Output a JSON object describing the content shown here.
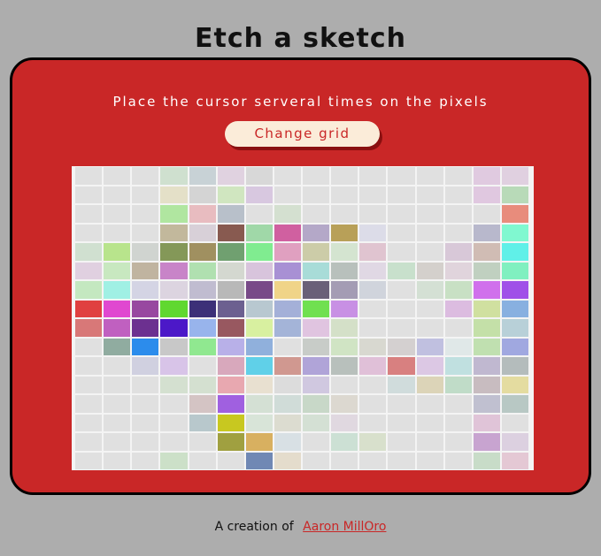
{
  "title": "Etch a sketch",
  "instruction": "Place the cursor serveral times on the pixels",
  "change_grid_label": "Change grid",
  "footer": {
    "prefix": "A creation of",
    "author": "Aaron MillOro"
  },
  "colors": {
    "background": "#adadad",
    "panel": "#c92727",
    "button_bg": "#fbecd9",
    "button_text": "#c92727",
    "empty_pixel": "#e0e0e0"
  },
  "grid": {
    "rows": 16,
    "cols": 16,
    "cells": [
      [
        "#e0e0e0",
        "#e0e0e0",
        "#e0e0e0",
        "#cfe0cf",
        "#c8d2d6",
        "#e0d2e0",
        "#d8d8d8",
        "#e0e0e0",
        "#e0e0e0",
        "#e0e0e0",
        "#e0e0e0",
        "#e0e0e0",
        "#e0e0e0",
        "#e0e0e0",
        "#e0cae0",
        "#e0d0e0"
      ],
      [
        "#e0e0e0",
        "#e0e0e0",
        "#e0e0e0",
        "#e4e0c8",
        "#d4d4d4",
        "#d0e6c0",
        "#d8c8e0",
        "#e0e0e0",
        "#e0e0e0",
        "#e0e0e0",
        "#e0e0e0",
        "#e0e0e0",
        "#e0e0e0",
        "#e0e0e0",
        "#e0c8e0",
        "#b8dab8"
      ],
      [
        "#e0e0e0",
        "#e0e0e0",
        "#e0e0e0",
        "#b0e6a0",
        "#e8bcc0",
        "#b8c0ca",
        "#e0e0e0",
        "#d4e0d0",
        "#e0e0e0",
        "#e0e0e0",
        "#e0e0e0",
        "#e0e0e0",
        "#e0e0e0",
        "#e0e0e0",
        "#e0e0e0",
        "#e88c7c"
      ],
      [
        "#e0e0e0",
        "#e0e0e0",
        "#e0e0e0",
        "#c2b89c",
        "#d8d0d8",
        "#885a50",
        "#a0d8a8",
        "#d060a0",
        "#b4a8c8",
        "#b8a058",
        "#dcdce8",
        "#e0e0e0",
        "#e0e0e0",
        "#e0e0e0",
        "#b8b8cc",
        "#80f8d0"
      ],
      [
        "#d0e0d0",
        "#b8e48c",
        "#d0d4d0",
        "#849858",
        "#a09060",
        "#70a070",
        "#80ec90",
        "#e0a0c0",
        "#cccca8",
        "#d4e4d0",
        "#e0c4d0",
        "#e0e0e0",
        "#e0e0e0",
        "#d8c8d8",
        "#d0bcb4",
        "#60f0e8"
      ],
      [
        "#e0d0e0",
        "#c8e8c0",
        "#c0b4a0",
        "#c884c8",
        "#b0e0b0",
        "#d4d8d0",
        "#d8c4dc",
        "#a890d4",
        "#a8dcd8",
        "#b8c0bc",
        "#e0d8e4",
        "#c8e0cc",
        "#d4d0cc",
        "#e0d4dc",
        "#c0d0c0",
        "#80f0c0"
      ],
      [
        "#c4e8c0",
        "#a0f0e4",
        "#d4d4e4",
        "#dcd4e0",
        "#c0bcd0",
        "#b8b8b8",
        "#784a88",
        "#f0d488",
        "#6a6078",
        "#a49cb4",
        "#d0d4dc",
        "#e0e0e0",
        "#d4e0d4",
        "#c8e0c4",
        "#d070ec",
        "#a050e8"
      ],
      [
        "#e04040",
        "#e048d0",
        "#9848a0",
        "#60d830",
        "#3c3078",
        "#6c6090",
        "#b8c8d0",
        "#a4b0d8",
        "#70e050",
        "#c890e4",
        "#e0e0e0",
        "#e0e0e0",
        "#e0e0e0",
        "#dcbce0",
        "#d0e0a0",
        "#88b0e0"
      ],
      [
        "#d87878",
        "#c060c0",
        "#6c3090",
        "#4c18c8",
        "#98b4ec",
        "#985860",
        "#d8f0a0",
        "#a4b4d8",
        "#e0c4e0",
        "#d4e0c8",
        "#e0e0e0",
        "#e0e0e0",
        "#e0e0e0",
        "#e0e0e0",
        "#c4e0a8",
        "#b8d0d8"
      ],
      [
        "#e0e0e0",
        "#90aca0",
        "#2c8cec",
        "#c8c8c8",
        "#90e890",
        "#b8b0e8",
        "#90b0dc",
        "#e0e0e0",
        "#c8ccc8",
        "#d0e4c4",
        "#d8d8d0",
        "#d4d0d0",
        "#c0c0e0",
        "#e0e8e8",
        "#c0e0b0",
        "#a0a8e0"
      ],
      [
        "#e0e0e0",
        "#e0e0e0",
        "#d0d0e0",
        "#d8c4e8",
        "#e0e0e0",
        "#d8a8bc",
        "#60d0e8",
        "#d09890",
        "#b0a4d8",
        "#b8c0bc",
        "#e0c0d8",
        "#d88080",
        "#dcc8e4",
        "#c0e0e0",
        "#c0b8d0",
        "#b4bcbc"
      ],
      [
        "#e0e0e0",
        "#e0e0e0",
        "#e0e0e0",
        "#d4e0d0",
        "#d4e0d0",
        "#e8a8b0",
        "#e8e0d0",
        "#dcdcdc",
        "#d0c8e0",
        "#e0e0e0",
        "#e0e0e0",
        "#d0dcdc",
        "#dcd4b8",
        "#c0dcc8",
        "#c8bcc0",
        "#e4dca0"
      ],
      [
        "#e0e0e0",
        "#e0e0e0",
        "#e0e0e0",
        "#e0e0e0",
        "#d4c4c4",
        "#a060e0",
        "#d4e0d4",
        "#d0dcd8",
        "#c8d8c8",
        "#dcd8d0",
        "#e0e0e0",
        "#e0e0e0",
        "#e0e0e0",
        "#e0e0e0",
        "#c0c0d0",
        "#b8c8c4"
      ],
      [
        "#e0e0e0",
        "#e0e0e0",
        "#e0e0e0",
        "#e0e0e0",
        "#b8c8cc",
        "#c8c820",
        "#d8e4d8",
        "#dcdcd0",
        "#d4e0d4",
        "#e0d8e0",
        "#e0e0e0",
        "#e0e0e0",
        "#e0e0e0",
        "#e0e0e0",
        "#e0c4d8",
        "#e0e0e0"
      ],
      [
        "#e0e0e0",
        "#e0e0e0",
        "#e0e0e0",
        "#e0e0e0",
        "#e0e0e0",
        "#a0a040",
        "#d8b060",
        "#d8e0e4",
        "#e0e0e0",
        "#cce0d4",
        "#d8e0cc",
        "#e0e0e0",
        "#e0e0e0",
        "#e0e0e0",
        "#c8a4d0",
        "#dcd0e0"
      ],
      [
        "#e0e0e0",
        "#e0e0e0",
        "#e0e0e0",
        "#cce0c8",
        "#e0e0e0",
        "#e0e0e0",
        "#7088b4",
        "#e4dccc",
        "#e0e0e0",
        "#e0e0e0",
        "#e0e0e0",
        "#e0e0e0",
        "#e0e0e0",
        "#e0e0e0",
        "#c8dcc8",
        "#e4c8d4"
      ]
    ]
  }
}
